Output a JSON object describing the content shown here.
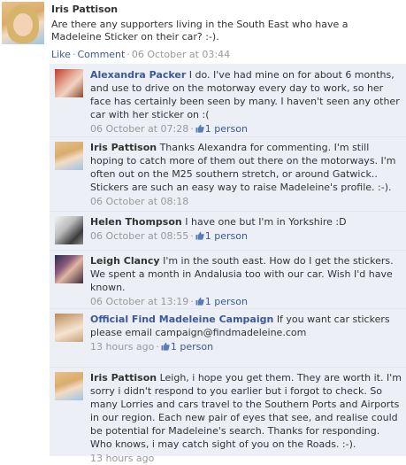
{
  "post": {
    "author": "Iris Pattison",
    "text": "Are there any supporters living in the South East who have a Madeleine Sticker on their car? :-).",
    "actions": {
      "like": "Like",
      "comment": "Comment",
      "timestamp": "06 October at 03:44"
    }
  },
  "comments": [
    {
      "author": "Alexandra Packer",
      "text": "I do. I've had mine on for about 6 months, and use to drive on the motorway every day to work, so her face has certainly been seen by many. I haven't seen any other car with her sticker on :(",
      "timestamp": "06 October at 07:28",
      "likes": "1 person"
    },
    {
      "author": "Iris Pattison",
      "text": "Thanks Alexandra for commenting. I'm still hoping to catch more of them out there on the motorways. I'm often out on the M25 southern stretch, or around Gatwick.. Stickers are such an easy way to raise Madeleine's profile. :-).",
      "timestamp": "06 October at 08:18"
    },
    {
      "author": "Helen Thompson",
      "text": "I have one but I'm in Yorkshire :D",
      "timestamp": "06 October at 08:55",
      "likes": "1 person"
    },
    {
      "author": "Leigh Clancy",
      "text": "I'm in the south east. How do I get the stickers. We spent a month in Andalusia too with our car. Wish I'd have known.",
      "timestamp": "06 October at 13:19",
      "likes": "1 person"
    },
    {
      "author": "Official Find Madeleine Campaign",
      "text": "If you want car stickers please email campaign@findmadeleine.com",
      "timestamp": "13 hours ago",
      "likes": "1 person"
    },
    {
      "author": "Iris Pattison",
      "text": "Leigh, i hope you get them. They are worth it. I'm sorry i didn't respond to you earlier but i forgot to check. So many Lorries and cars travel to the Southern Ports and Airports in our region. Each new pair of eyes that see, and realise could be potential for Madeleine's search. Thanks for responding. Who knows, i may catch sight of you on the Roads. :-).",
      "timestamp": "13 hours ago"
    }
  ],
  "colors": {
    "link": "#3b5998",
    "thread_bg": "#eceff5",
    "muted": "#999999"
  },
  "icons": {
    "like": "thumbs-up-icon"
  }
}
